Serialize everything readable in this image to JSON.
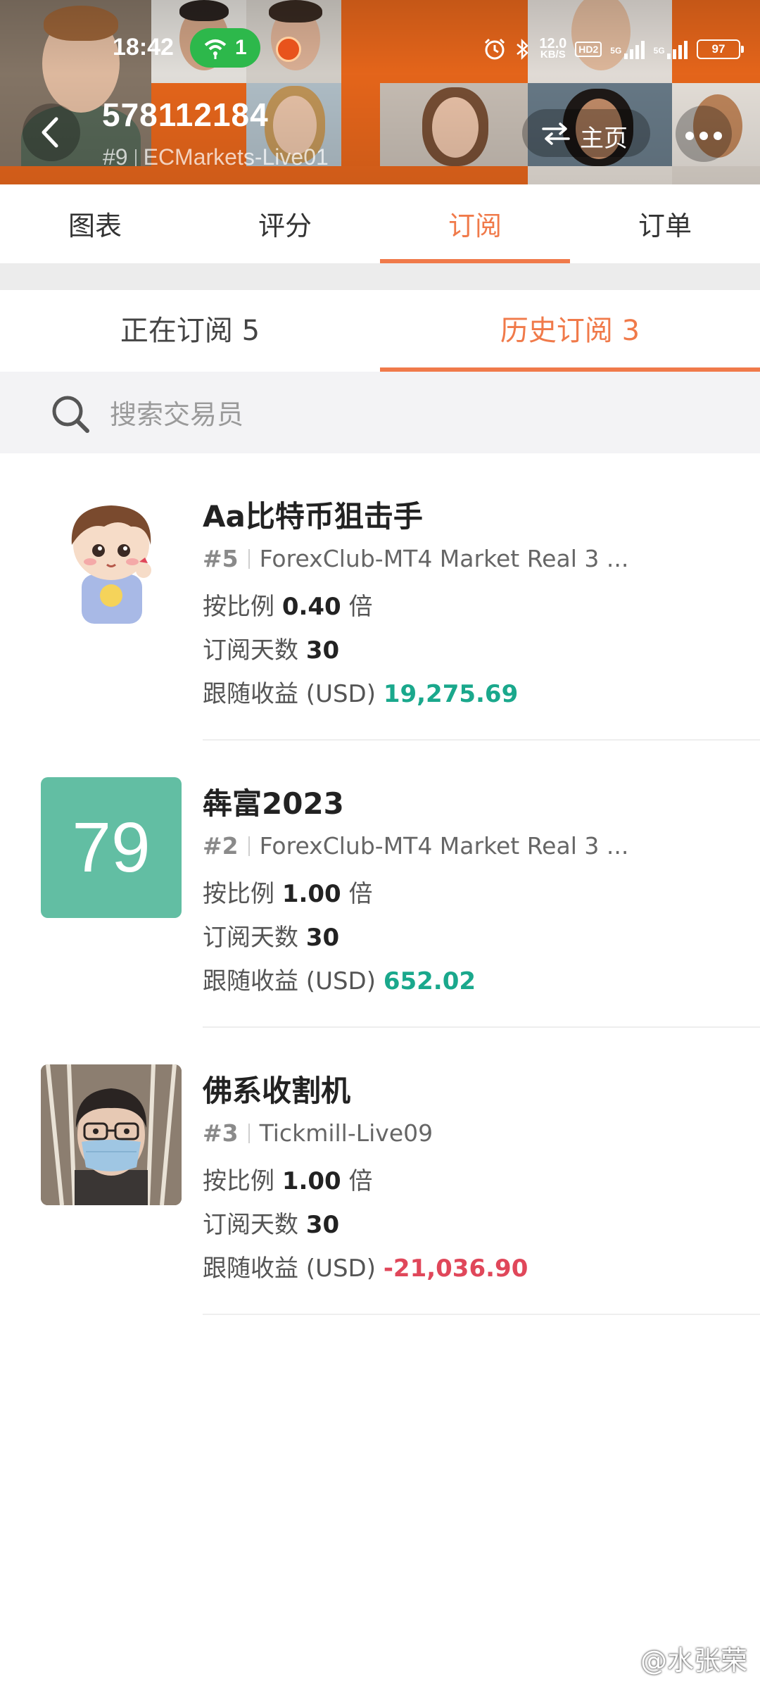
{
  "status_bar": {
    "time": "18:42",
    "hotspot_count": "1",
    "net_speed_value": "12.0",
    "net_speed_unit": "KB/S",
    "hd_label": "HD2",
    "signal1": "5G",
    "signal2": "5G",
    "battery": "97"
  },
  "header": {
    "account_id": "578112184",
    "rank": "#9",
    "server": "ECMarkets-Live01",
    "home_label": "主页",
    "icons": {
      "back": "chevron-left-icon",
      "home": "swap-arrows-icon",
      "more": "more-dots-icon"
    }
  },
  "main_tabs": [
    {
      "label": "图表",
      "active": false
    },
    {
      "label": "评分",
      "active": false
    },
    {
      "label": "订阅",
      "active": true
    },
    {
      "label": "订单",
      "active": false
    }
  ],
  "sub_tabs": [
    {
      "label": "正在订阅 5",
      "active": false
    },
    {
      "label": "历史订阅 3",
      "active": true
    }
  ],
  "search": {
    "placeholder": "搜索交易员"
  },
  "list_labels": {
    "ratio_prefix": "按比例",
    "ratio_suffix": "倍",
    "days_prefix": "订阅天数",
    "profit_prefix": "跟随收益 (USD)"
  },
  "traders": [
    {
      "name": "Aa比特币狙击手",
      "rank": "#5",
      "server": "ForexClub-MT4 Market Real 3 ...",
      "ratio": "0.40",
      "days": "30",
      "profit": "19,275.69",
      "profit_sign": "positive",
      "avatar": "cartoon-boy-avatar"
    },
    {
      "name": "犇富2023",
      "rank": "#2",
      "server": "ForexClub-MT4 Market Real 3 ...",
      "ratio": "1.00",
      "days": "30",
      "profit": "652.02",
      "profit_sign": "positive",
      "avatar_text": "79",
      "avatar_color": "#62bea3"
    },
    {
      "name": "佛系收割机",
      "rank": "#3",
      "server": "Tickmill-Live09",
      "ratio": "1.00",
      "days": "30",
      "profit": "-21,036.90",
      "profit_sign": "negative",
      "avatar": "masked-person-avatar"
    }
  ],
  "colors": {
    "accent": "#f07a4a",
    "positive": "#1aa88c",
    "negative": "#e0475a",
    "banner_orange": "#f06a1c"
  },
  "watermark": "@水张荣"
}
